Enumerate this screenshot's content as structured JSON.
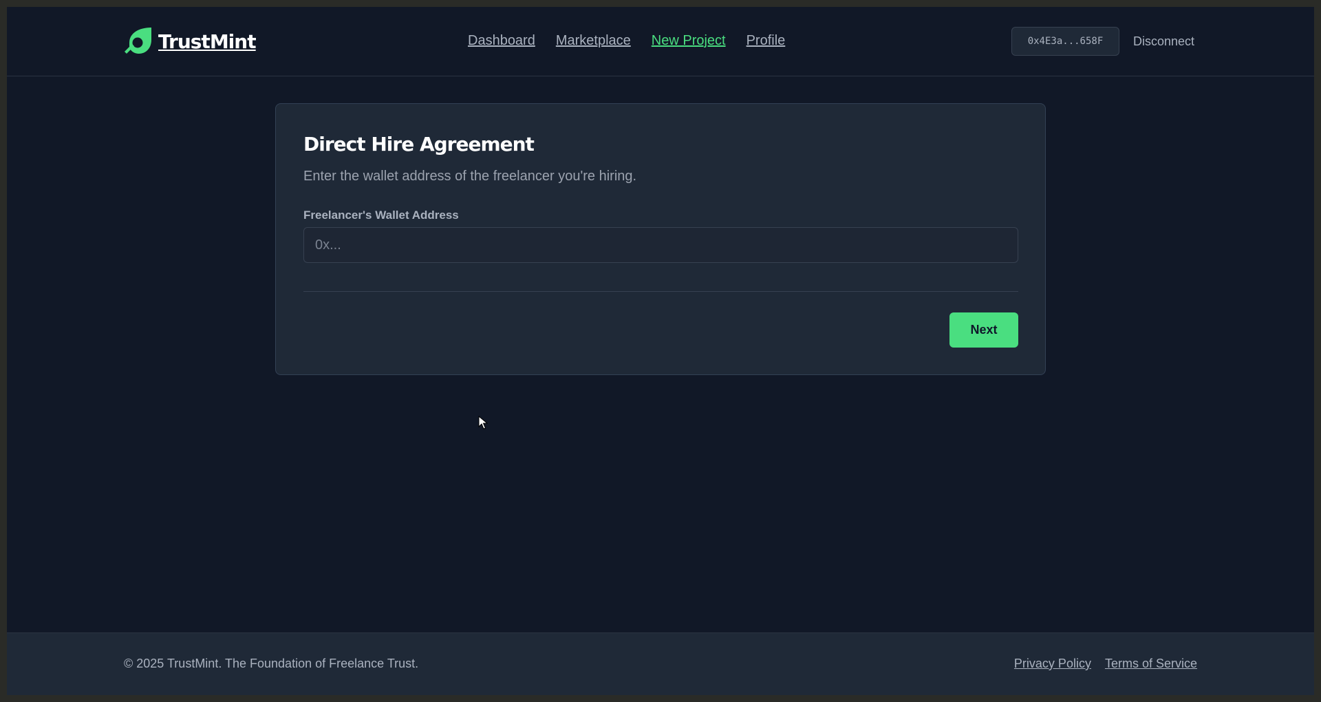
{
  "brand": {
    "name": "TrustMint",
    "logo_icon": "leaf-magnifier-icon",
    "accent_color": "#4ade80"
  },
  "nav": {
    "items": [
      {
        "label": "Dashboard",
        "active": false
      },
      {
        "label": "Marketplace",
        "active": false
      },
      {
        "label": "New Project",
        "active": true
      },
      {
        "label": "Profile",
        "active": false
      }
    ]
  },
  "account": {
    "wallet_short": "0x4E3a...658F",
    "disconnect_label": "Disconnect"
  },
  "form": {
    "title": "Direct Hire Agreement",
    "subtitle": "Enter the wallet address of the freelancer you're hiring.",
    "wallet_label": "Freelancer's Wallet Address",
    "wallet_value": "",
    "wallet_placeholder": "0x...",
    "next_label": "Next"
  },
  "footer": {
    "copyright": "© 2025 TrustMint. The Foundation of Freelance Trust.",
    "links": [
      "Privacy Policy",
      "Terms of Service"
    ]
  }
}
